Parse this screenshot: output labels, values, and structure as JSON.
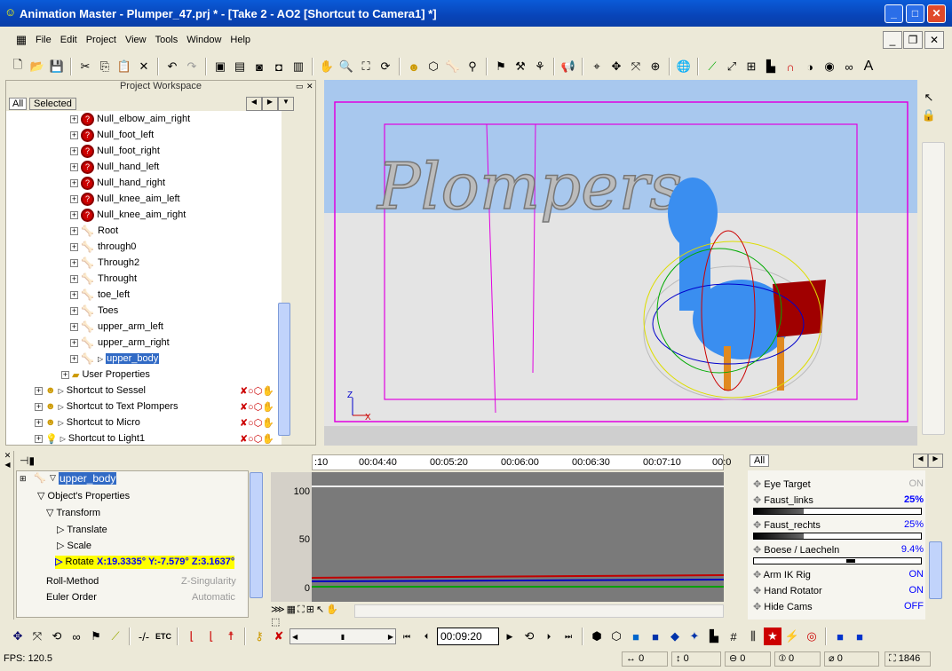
{
  "window": {
    "title": "Animation Master - Plumper_47.prj * - [Take 2 - AO2 [Shortcut to Camera1] *]",
    "minimize": "_",
    "maximize": "□",
    "close": "✕"
  },
  "menu": [
    "File",
    "Edit",
    "Project",
    "View",
    "Tools",
    "Window",
    "Help"
  ],
  "workspace": {
    "title": "Project Workspace",
    "tabs": [
      "All",
      "Selected"
    ],
    "items": [
      {
        "name": "Null_elbow_aim_right",
        "type": "null"
      },
      {
        "name": "Null_foot_left",
        "type": "null"
      },
      {
        "name": "Null_foot_right",
        "type": "null"
      },
      {
        "name": "Null_hand_left",
        "type": "null"
      },
      {
        "name": "Null_hand_right",
        "type": "null"
      },
      {
        "name": "Null_knee_aim_left",
        "type": "null"
      },
      {
        "name": "Null_knee_aim_right",
        "type": "null"
      },
      {
        "name": "Root",
        "type": "bone"
      },
      {
        "name": "through0",
        "type": "bone"
      },
      {
        "name": "Through2",
        "type": "bone"
      },
      {
        "name": "Throught",
        "type": "bone"
      },
      {
        "name": "toe_left",
        "type": "bone"
      },
      {
        "name": "Toes",
        "type": "bone"
      },
      {
        "name": "upper_arm_left",
        "type": "bone"
      },
      {
        "name": "upper_arm_right",
        "type": "bone"
      },
      {
        "name": "upper_body",
        "type": "bone",
        "selected": true
      }
    ],
    "user_properties": "User Properties",
    "shortcuts": [
      "Shortcut to Sessel",
      "Shortcut to Text Plompers",
      "Shortcut to Micro",
      "Shortcut to Light1"
    ]
  },
  "viewport": {
    "text_object": "Plompers",
    "axis_z": "Z",
    "axis_x": "X"
  },
  "properties": {
    "object": "upper_body",
    "group": "Object's Properties",
    "transform": "Transform",
    "translate": "Translate",
    "scale": "Scale",
    "rotate_label": "Rotate",
    "rotate_value": "X:19.3335°  Y:-7.579°  Z:3.1637°",
    "roll_method": "Roll-Method",
    "roll_method_value": "Z-Singularity",
    "euler_order": "Euler Order",
    "euler_order_value": "Automatic"
  },
  "timeline": {
    "ticks": [
      ":10",
      "00:04:40",
      "00:05:20",
      "00:06:00",
      "00:06:30",
      "00:07:10",
      "00:0"
    ],
    "y_labels": [
      "100",
      "50",
      "0"
    ],
    "series_colors": [
      "#c00000",
      "#0000c0",
      "#00a000"
    ]
  },
  "pose_panel": {
    "tab": "All",
    "items": [
      {
        "name": "Eye Target",
        "value": "ON",
        "disabled": true
      },
      {
        "name": "Faust_links",
        "value": "25%",
        "slider": 25,
        "bold": true
      },
      {
        "name": "Faust_rechts",
        "value": "25%",
        "slider": 25
      },
      {
        "name": "Boese / Laecheln",
        "value": "9.4%",
        "slider": 9.4
      },
      {
        "name": "Arm IK Rig",
        "value": "ON"
      },
      {
        "name": "Hand Rotator",
        "value": "ON"
      },
      {
        "name": "Hide Cams",
        "value": "OFF"
      }
    ]
  },
  "bottom_toolbar": {
    "etc": "ETC",
    "time": "00:09:20"
  },
  "status": {
    "fps": "FPS: 120.5",
    "x": "0",
    "y": "0",
    "rx": "0",
    "ry": "0",
    "rz": "0",
    "count": "1846"
  }
}
